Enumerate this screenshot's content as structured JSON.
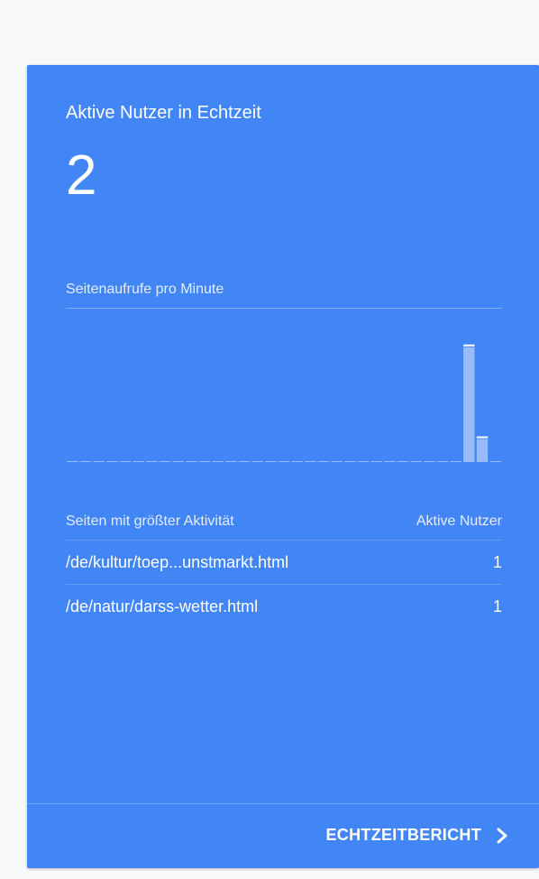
{
  "card": {
    "title": "Aktive Nutzer in Echtzeit",
    "active_users": "2",
    "chart_label": "Seitenaufrufe pro Minute",
    "accent_color": "#4285f4"
  },
  "chart_data": {
    "type": "bar",
    "title": "Seitenaufrufe pro Minute",
    "values": [
      0,
      0,
      0,
      0,
      0,
      0,
      0,
      0,
      0,
      0,
      0,
      0,
      0,
      0,
      0,
      0,
      0,
      0,
      0,
      0,
      0,
      0,
      0,
      0,
      0,
      0,
      0,
      0,
      0,
      0,
      2,
      0.4,
      0
    ],
    "ylim": [
      0,
      2.2
    ],
    "grid": false
  },
  "table": {
    "header_page": "Seiten mit größter Aktivität",
    "header_users": "Aktive Nutzer",
    "rows": [
      {
        "page": "/de/kultur/toep...unstmarkt.html",
        "users": "1"
      },
      {
        "page": "/de/natur/darss-wetter.html",
        "users": "1"
      }
    ]
  },
  "footer": {
    "report_label": "ECHTZEITBERICHT",
    "icon": "chevron-right-icon"
  }
}
